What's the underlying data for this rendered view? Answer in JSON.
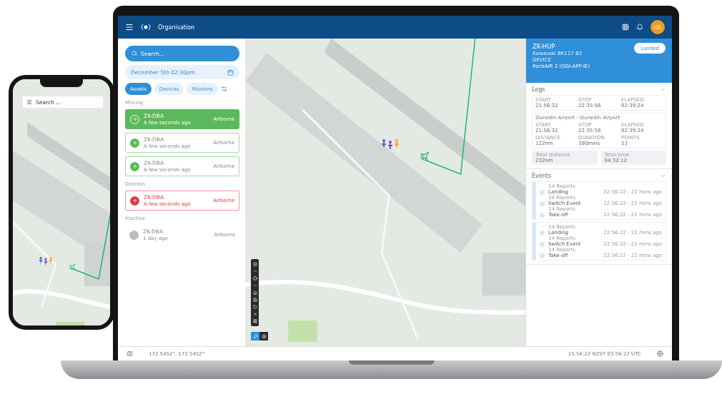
{
  "top_bar": {
    "title": "Organisation",
    "avatar": "US"
  },
  "sidebar": {
    "search": {
      "placeholder": "Search..."
    },
    "date": "December 5th 02:30pm",
    "tabs": [
      {
        "label": "Assets",
        "selected": true
      },
      {
        "label": "Devices",
        "selected": false
      },
      {
        "label": "Missions",
        "selected": false
      }
    ],
    "sections": [
      {
        "label": "Moving",
        "assets": [
          {
            "name": "ZK-DBA",
            "time": "A few seconds ago",
            "status": "Airborne",
            "kind": "moving",
            "selected": true
          },
          {
            "name": "ZK-DBA",
            "time": "A few seconds ago",
            "status": "Airborne",
            "kind": "moving",
            "selected": false
          },
          {
            "name": "ZK-DBA",
            "time": "A few seconds ago",
            "status": "Airborne",
            "kind": "moving",
            "selected": false
          }
        ]
      },
      {
        "label": "Distress",
        "assets": [
          {
            "name": "ZK-DBA",
            "time": "A few seconds ago",
            "status": "Airborne",
            "kind": "distress",
            "selected": false
          }
        ]
      },
      {
        "label": "Inactive",
        "assets": [
          {
            "name": "ZK-DBA",
            "time": "1 day ago",
            "status": "Airborne",
            "kind": "inactive",
            "selected": false
          }
        ]
      }
    ]
  },
  "details": {
    "callsign": "ZK-HUP",
    "aircraft": "Kawasaki BK117 B2",
    "device_label": "DEVICE",
    "device": "RockAIR 2 (OGI-APP-IE)",
    "status": "Landed",
    "legs": {
      "title": "Legs",
      "items": [
        {
          "stats": [
            {
              "label": "START",
              "value": "21:56:32"
            },
            {
              "label": "STOP",
              "value": "22:35:56"
            },
            {
              "label": "ELAPSED",
              "value": "02:39:24"
            }
          ]
        },
        {
          "route": "Dunedin Airport - Dunedin Airport",
          "stats": [
            {
              "label": "START",
              "value": "21:56:32"
            },
            {
              "label": "STOP",
              "value": "22:35:56"
            },
            {
              "label": "ELAPSED",
              "value": "02:39:24"
            },
            {
              "label": "DISTANCE",
              "value": "122nm"
            },
            {
              "label": "DURATION",
              "value": "390mins"
            },
            {
              "label": "POINTS",
              "value": "13"
            }
          ]
        }
      ],
      "totals": [
        {
          "label": "Total distance",
          "value": "232nm"
        },
        {
          "label": "Total time",
          "value": "04:32:12"
        }
      ]
    },
    "events": {
      "title": "Events",
      "groups": [
        {
          "items": [
            {
              "reports": "14 Reports",
              "name": "Landing",
              "time": "22:56:22 - 22 mins ago"
            },
            {
              "reports": "14 Reports",
              "name": "Switch Event",
              "time": "22:56:22 - 22 mins ago"
            },
            {
              "reports": "14 Reports",
              "name": "Take-off",
              "time": "22:56:22 - 22 mins ago"
            }
          ]
        },
        {
          "items": [
            {
              "reports": "14 Reports",
              "name": "Landing",
              "time": "22:56:22 - 22 mins ago"
            },
            {
              "reports": "14 Reports",
              "name": "Switch Event",
              "time": "22:56:22 - 22 mins ago"
            },
            {
              "reports": "14 Reports",
              "name": "Take-off",
              "time": "22:56:22 - 22 mins ago"
            }
          ]
        }
      ]
    }
  },
  "status_bar": {
    "coordinates": "172.5452°, 172.5452°",
    "time": "15:56:22 NZST 03:56:22 UTC"
  },
  "phone": {
    "search": {
      "placeholder": "Search ..."
    }
  }
}
